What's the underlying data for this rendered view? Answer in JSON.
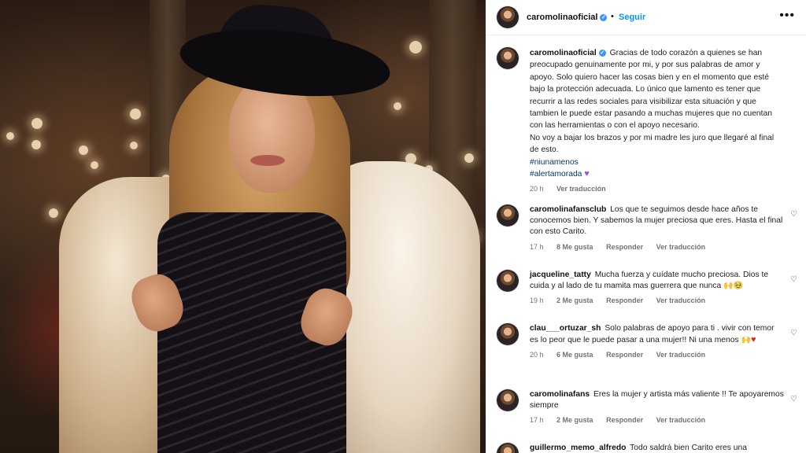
{
  "post": {
    "username": "caromolinaoficial",
    "follow_label": "Seguir",
    "separator": "•",
    "more_icon": "more-options-icon",
    "caption": {
      "line1": "Gracias de todo corazón a quienes se han preocupado genuinamente por mi, y por sus palabras de amor y apoyo. Solo quiero hacer las cosas bien y en el momento que esté bajo la protección adecuada. Lo único que lamento es tener que recurrir a las redes sociales para visibilizar esta situación y que tambien le puede estar pasando a muchas mujeres que no cuentan con las herramientas o con el apoyo necesario.",
      "line2": "No voy a bajar los brazos y por mi madre les juro que llegaré al final de esto.",
      "tag1": "#niunamenos",
      "tag2": "#alertamorada",
      "time": "20 h",
      "translate": "Ver traducción"
    }
  },
  "comments": [
    {
      "username": "caromolinafansclub",
      "text": "Los que te seguimos desde hace años te conocemos bien. Y sabemos la mujer preciosa que eres. Hasta el final con esto Carito.",
      "time": "17 h",
      "likes": "8 Me gusta",
      "reply": "Responder",
      "translate": "Ver traducción"
    },
    {
      "username": "jacqueline_tatty",
      "text": "Mucha fuerza y cuídate mucho preciosa. Dios te cuida y al lado de tu mamita mas guerrera que nunca",
      "time": "19 h",
      "likes": "2 Me gusta",
      "reply": "Responder",
      "translate": "Ver traducción"
    },
    {
      "username": "clau___ortuzar_sh",
      "text": "Solo palabras de apoyo para ti . vivir con temor es lo peor que le puede pasar a una mujer!! Ni una menos",
      "time": "20 h",
      "likes": "6 Me gusta",
      "reply": "Responder",
      "translate": "Ver traducción"
    },
    {
      "username": "caromolinafans",
      "text": "Eres la mujer y artista más valiente !! Te apoyaremos siempre",
      "time": "17 h",
      "likes": "2 Me gusta",
      "reply": "Responder",
      "translate": "Ver traducción"
    },
    {
      "username": "guillermo_memo_alfredo",
      "text": "Todo saldrá bien Carito eres una"
    }
  ],
  "colors": {
    "link": "#0095f6",
    "hashtag": "#00376b",
    "verified": "#3b97f2",
    "muted": "#737373"
  }
}
